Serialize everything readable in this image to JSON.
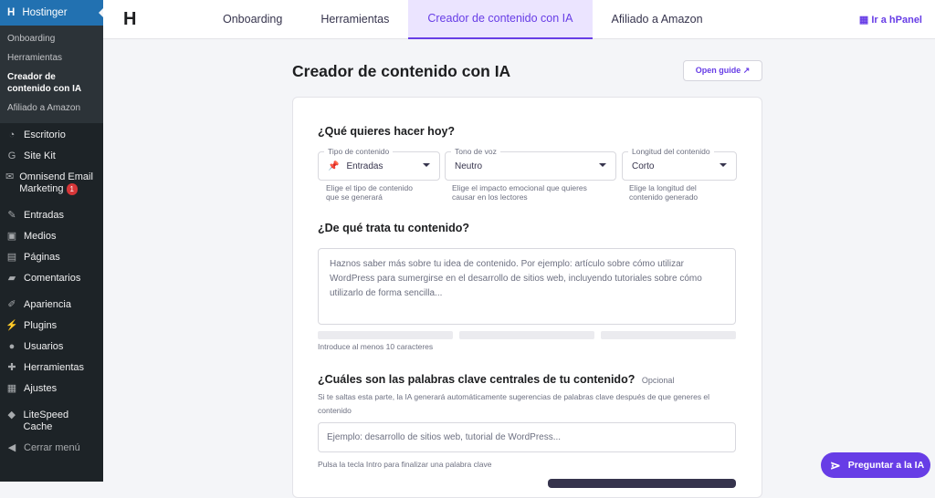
{
  "sidebar": {
    "brand": "Hostinger",
    "sub": [
      "Onboarding",
      "Herramientas",
      "Creador de contenido con IA",
      "Afiliado a Amazon"
    ],
    "items": [
      {
        "icon": "dashboard-icon",
        "g": "◔",
        "label": "Escritorio"
      },
      {
        "icon": "google-icon",
        "g": "G",
        "label": "Site Kit"
      },
      {
        "icon": "mail-icon",
        "g": "✉",
        "label": "Omnisend Email Marketing",
        "badge": "1"
      },
      {
        "icon": "pin-icon",
        "g": "✎",
        "label": "Entradas"
      },
      {
        "icon": "media-icon",
        "g": "▣",
        "label": "Medios"
      },
      {
        "icon": "page-icon",
        "g": "▤",
        "label": "Páginas"
      },
      {
        "icon": "comment-icon",
        "g": "▰",
        "label": "Comentarios"
      },
      {
        "icon": "brush-icon",
        "g": "✐",
        "label": "Apariencia"
      },
      {
        "icon": "plugin-icon",
        "g": "⚡",
        "label": "Plugins"
      },
      {
        "icon": "user-icon",
        "g": "●",
        "label": "Usuarios"
      },
      {
        "icon": "wrench-icon",
        "g": "✚",
        "label": "Herramientas"
      },
      {
        "icon": "settings-icon",
        "g": "▦",
        "label": "Ajustes"
      },
      {
        "icon": "litespeed-icon",
        "g": "◆",
        "label": "LiteSpeed Cache"
      },
      {
        "icon": "collapse-icon",
        "g": "◀",
        "label": "Cerrar menú"
      }
    ]
  },
  "tabs": [
    "Onboarding",
    "Herramientas",
    "Creador de contenido con IA",
    "Afiliado a Amazon"
  ],
  "hpanel": "Ir a hPanel",
  "title": "Creador de contenido con IA",
  "guide": "Open guide ↗",
  "q1": "¿Qué quieres hacer hoy?",
  "selects": [
    {
      "label": "Tipo de contenido",
      "value": "Entradas",
      "help": "Elige el tipo de contenido que se generará"
    },
    {
      "label": "Tono de voz",
      "value": "Neutro",
      "help": "Elige el impacto emocional que quieres causar en los lectores"
    },
    {
      "label": "Longitud del contenido",
      "value": "Corto",
      "help": "Elige la longitud del contenido generado"
    }
  ],
  "q2": "¿De qué trata tu contenido?",
  "ta_placeholder": "Haznos saber más sobre tu idea de contenido. Por ejemplo: artículo sobre cómo utilizar WordPress para sumergirse en el desarrollo de sitios web, incluyendo tutoriales sobre cómo utilizarlo de forma sencilla...",
  "min_chars": "Introduce al menos 10 caracteres",
  "q3": "¿Cuáles son las palabras clave centrales de tu contenido?",
  "optional": "Opcional",
  "q3_help": "Si te saltas esta parte, la IA generará automáticamente sugerencias de palabras clave después de que generes el contenido",
  "kw_placeholder": "Ejemplo: desarrollo de sitios web, tutorial de WordPress...",
  "kw_help": "Pulsa la tecla Intro para finalizar una palabra clave",
  "ask": "Preguntar a la IA"
}
